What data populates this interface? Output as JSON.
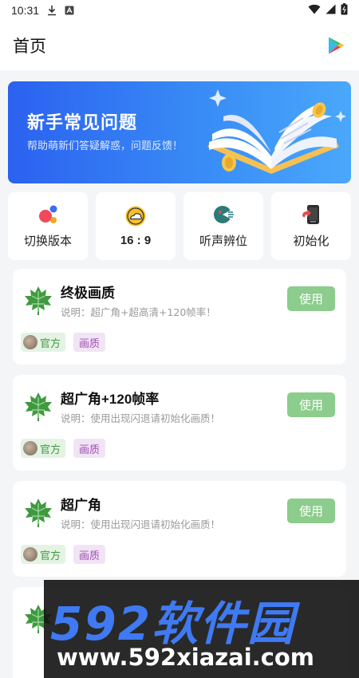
{
  "status_bar": {
    "time": "10:31"
  },
  "app_bar": {
    "title": "首页"
  },
  "banner": {
    "title": "新手常见问题",
    "subtitle": "帮助萌新们答疑解惑，问题反馈！"
  },
  "quick_actions": [
    {
      "label": "切换版本",
      "icon": "dots-icon"
    },
    {
      "label": "16 : 9",
      "icon": "cloud-sun-icon"
    },
    {
      "label": "听声辨位",
      "icon": "sound-icon"
    },
    {
      "label": "初始化",
      "icon": "phone-refresh-icon"
    }
  ],
  "cards": [
    {
      "title": "终极画质",
      "desc": "说明：超广角+超高清+120帧率！",
      "button": "使用",
      "tag_official": "官方",
      "tag_type": "画质"
    },
    {
      "title": "超广角+120帧率",
      "desc": "说明：使用出现闪退请初始化画质！",
      "button": "使用",
      "tag_official": "官方",
      "tag_type": "画质"
    },
    {
      "title": "超广角",
      "desc": "说明：使用出现闪退请初始化画质！",
      "button": "使用",
      "tag_official": "官方",
      "tag_type": "画质"
    }
  ],
  "watermark": {
    "brand": "592软件园",
    "url": "www.592xiazai.com"
  },
  "colors": {
    "banner_start": "#2b61f0",
    "banner_end": "#4aa8fb",
    "use_button": "#8ccc8c",
    "tag_official_bg": "#e4f3e4",
    "tag_type_bg": "#f1e4f4",
    "watermark_blue": "#3f7af3"
  }
}
